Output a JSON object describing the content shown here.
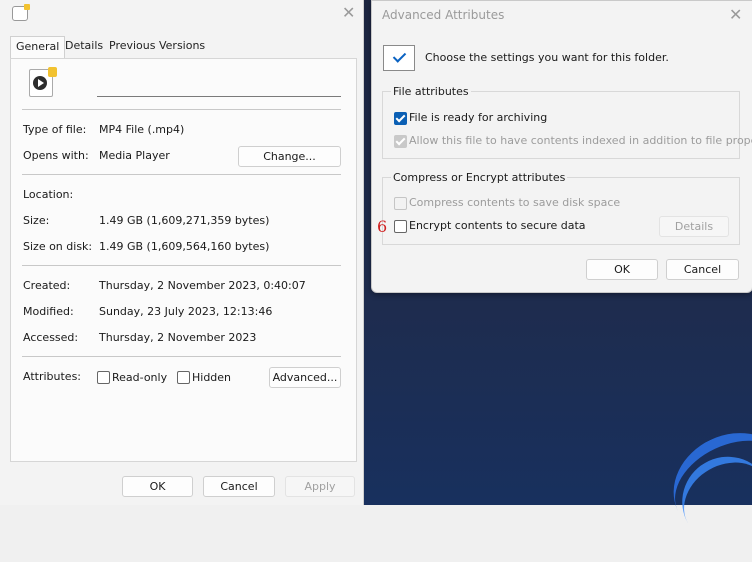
{
  "properties": {
    "tabs": [
      "General",
      "Details",
      "Previous Versions"
    ],
    "file_name_value": "",
    "type_label": "Type of file:",
    "type_value": "MP4 File (.mp4)",
    "opens_label": "Opens with:",
    "opens_value": "Media Player",
    "change_button": "Change...",
    "location_label": "Location:",
    "location_value": "",
    "size_label": "Size:",
    "size_value": "1.49 GB (1,609,271,359 bytes)",
    "size_on_disk_label": "Size on disk:",
    "size_on_disk_value": "1.49 GB (1,609,564,160 bytes)",
    "created_label": "Created:",
    "created_value": "Thursday, 2 November 2023, 0:40:07",
    "modified_label": "Modified:",
    "modified_value": "Sunday, 23 July 2023, 12:13:46",
    "accessed_label": "Accessed:",
    "accessed_value": "Thursday, 2 November 2023",
    "attributes_label": "Attributes:",
    "readonly_label": "Read-only",
    "hidden_label": "Hidden",
    "advanced_button": "Advanced...",
    "ok_button": "OK",
    "cancel_button": "Cancel",
    "apply_button": "Apply"
  },
  "advanced": {
    "title": "Advanced Attributes",
    "intro": "Choose the settings you want for this folder.",
    "file_attributes_title": "File attributes",
    "archive_label": "File is ready for archiving",
    "index_label": "Allow this file to have contents indexed in addition to file properties",
    "compress_encrypt_title": "Compress or Encrypt attributes",
    "compress_label": "Compress contents to save disk space",
    "encrypt_label": "Encrypt contents to secure data",
    "details_button": "Details",
    "ok_button": "OK",
    "cancel_button": "Cancel"
  },
  "annotation": "6",
  "icons": [
    "close-icon",
    "file-icon",
    "media-file-icon",
    "checkmark-icon"
  ],
  "colors": {
    "accent": "#0a5fb4",
    "annotation": "#d02020",
    "desktop": "#1b2a4a"
  }
}
